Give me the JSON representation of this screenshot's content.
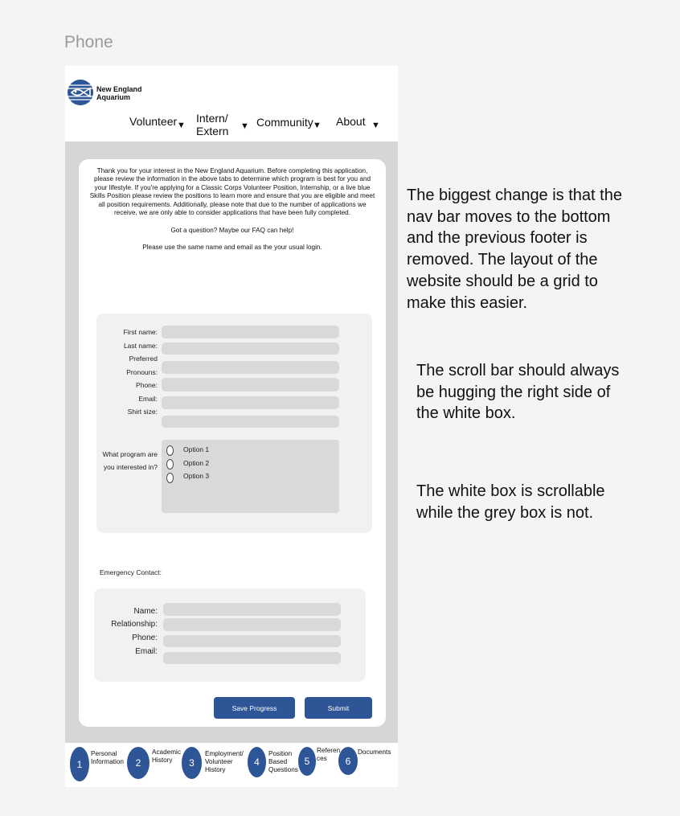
{
  "frame_label": "Phone",
  "brand": {
    "line1": "New England",
    "line2": "Aquarium"
  },
  "nav": {
    "volunteer": "Volunteer",
    "intern_line1": "Intern/",
    "intern_line2": "Extern",
    "community": "Community",
    "about": "About",
    "caret": "▼"
  },
  "intro": {
    "paragraph": "Thank you for your interest in the New England Aquarium. Before completing this application, please review the information in the above tabs to determine which program is best for you and your lifestyle. If you're applying for a Classic Corps Volunteer Position, Internship, or a live blue Skills Position please review the positions to learn more and ensure that you are eligible and meet all position requirements. Additionally, please note that due to the number of applications we receive, we are only able to consider applications that have been fully completed.",
    "faq": "Got a question? Maybe our FAQ can help!",
    "login": "Please use the same name and email as the your usual login."
  },
  "form": {
    "first_name": "First name:",
    "last_name": "Last name:",
    "preferred": "Preferred",
    "pronouns": "Pronouns:",
    "phone": "Phone:",
    "email": "Email:",
    "shirt_size": "Shirt size:",
    "program_q1": "What program are",
    "program_q2": "you interested in?",
    "options": [
      "Option 1",
      "Option 2",
      "Option 3"
    ]
  },
  "emergency": {
    "title": "Emergency Contact:",
    "name": "Name:",
    "relationship": "Relationship:",
    "phone": "Phone:",
    "email": "Email:"
  },
  "buttons": {
    "save": "Save Progress",
    "submit": "Submit"
  },
  "steps": [
    {
      "num": "1",
      "label": "Personal\nInformation"
    },
    {
      "num": "2",
      "label": "Academic\nHistory"
    },
    {
      "num": "3",
      "label": "Employment/\nVolunteer\nHistory"
    },
    {
      "num": "4",
      "label": "Position\nBased\nQuestions"
    },
    {
      "num": "5",
      "label": "Referen\nces"
    },
    {
      "num": "6",
      "label": "Documents"
    }
  ],
  "notes": {
    "note1": "The biggest change is that the nav bar moves to the bottom and the previous footer is removed. The layout of the website should be a grid to make this easier.",
    "note2": "The scroll bar should always be hugging the right side of the white box.",
    "note3": "The white box is scrollable while the grey box is not."
  },
  "colors": {
    "accent": "#2e5596",
    "grey_bg": "#d6d6d6",
    "field": "#d9d9d9",
    "panel": "#f1f1f1"
  }
}
